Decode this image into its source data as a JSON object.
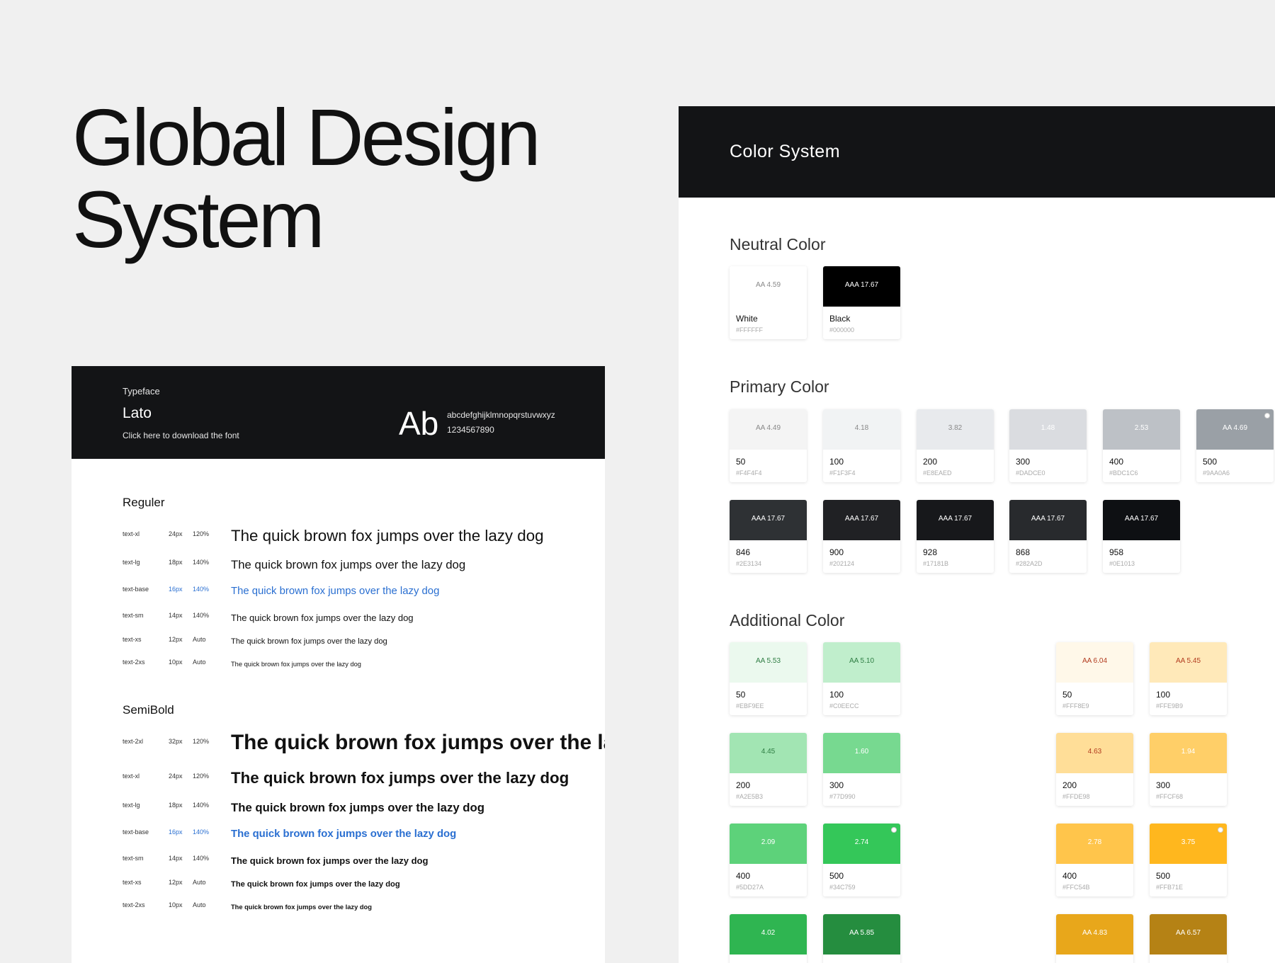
{
  "hero": {
    "line1": "Global Design",
    "line2": "System"
  },
  "typeface": {
    "label": "Typeface",
    "name": "Lato",
    "download": "Click here to download the font",
    "sample": "Ab",
    "alphabet": "abcdefghijklmnopqrstuvwxyz",
    "digits": "1234567890",
    "regular": {
      "title": "Reguler",
      "rows": [
        {
          "token": "text-xl",
          "size": "24px",
          "lh": "120%",
          "text": "The quick brown fox jumps over the lazy dog"
        },
        {
          "token": "text-lg",
          "size": "18px",
          "lh": "140%",
          "text": "The quick brown fox jumps over the lazy dog"
        },
        {
          "token": "text-base",
          "size": "16px",
          "lh": "140%",
          "text": "The quick brown fox jumps over the lazy dog"
        },
        {
          "token": "text-sm",
          "size": "14px",
          "lh": "140%",
          "text": "The quick brown fox jumps over the lazy dog"
        },
        {
          "token": "text-xs",
          "size": "12px",
          "lh": "Auto",
          "text": "The quick brown fox jumps over the lazy dog"
        },
        {
          "token": "text-2xs",
          "size": "10px",
          "lh": "Auto",
          "text": "The quick brown fox jumps over the lazy dog"
        }
      ]
    },
    "semibold": {
      "title": "SemiBold",
      "rows": [
        {
          "token": "text-2xl",
          "size": "32px",
          "lh": "120%",
          "text": "The quick brown fox jumps over the lazy dog"
        },
        {
          "token": "text-xl",
          "size": "24px",
          "lh": "120%",
          "text": "The quick brown fox jumps over the lazy dog"
        },
        {
          "token": "text-lg",
          "size": "18px",
          "lh": "140%",
          "text": "The quick brown fox jumps over the lazy dog"
        },
        {
          "token": "text-base",
          "size": "16px",
          "lh": "140%",
          "text": "The quick brown fox jumps over the lazy dog"
        },
        {
          "token": "text-sm",
          "size": "14px",
          "lh": "140%",
          "text": "The quick brown fox jumps over the lazy dog"
        },
        {
          "token": "text-xs",
          "size": "12px",
          "lh": "Auto",
          "text": "The quick brown fox jumps over the lazy dog"
        },
        {
          "token": "text-2xs",
          "size": "10px",
          "lh": "Auto",
          "text": "The quick brown fox jumps over the lazy dog"
        }
      ]
    }
  },
  "colors": {
    "title": "Color System",
    "neutral_title": "Neutral Color",
    "primary_title": "Primary Color",
    "additional_title": "Additional Color",
    "neutral": [
      {
        "name": "White",
        "hex": "#FFFFFF",
        "ratio": "AA 4.59",
        "color": "#FFFFFF",
        "text": "#888888"
      },
      {
        "name": "Black",
        "hex": "#000000",
        "ratio": "AAA 17.67",
        "color": "#000000",
        "text": "#FFFFFF"
      }
    ],
    "primary": [
      {
        "name": "50",
        "hex": "#F4F4F4",
        "ratio": "AA 4.49",
        "color": "#F4F4F4",
        "text": "#888888"
      },
      {
        "name": "100",
        "hex": "#F1F3F4",
        "ratio": "4.18",
        "color": "#F1F3F4",
        "text": "#888888"
      },
      {
        "name": "200",
        "hex": "#E8EAED",
        "ratio": "3.82",
        "color": "#E8EAED",
        "text": "#888888"
      },
      {
        "name": "300",
        "hex": "#DADCE0",
        "ratio": "1.48",
        "color": "#DADCE0",
        "text": "#FFFFFF"
      },
      {
        "name": "400",
        "hex": "#BDC1C6",
        "ratio": "2.53",
        "color": "#BDC1C6",
        "text": "#FFFFFF"
      },
      {
        "name": "500",
        "hex": "#9AA0A6",
        "ratio": "AA 4.69",
        "color": "#9AA0A6",
        "text": "#FFFFFF",
        "selected": true
      },
      {
        "name": "846",
        "hex": "#2E3134",
        "ratio": "AAA 17.67",
        "color": "#2E3134",
        "text": "#FFFFFF"
      },
      {
        "name": "900",
        "hex": "#202124",
        "ratio": "AAA 17.67",
        "color": "#202124",
        "text": "#FFFFFF"
      },
      {
        "name": "928",
        "hex": "#17181B",
        "ratio": "AAA 17.67",
        "color": "#17181B",
        "text": "#FFFFFF"
      },
      {
        "name": "868",
        "hex": "#282A2D",
        "ratio": "AAA 17.67",
        "color": "#282A2D",
        "text": "#FFFFFF"
      },
      {
        "name": "958",
        "hex": "#0E1013",
        "ratio": "AAA 17.67",
        "color": "#0E1013",
        "text": "#FFFFFF"
      }
    ],
    "green": [
      {
        "name": "50",
        "hex": "#EBF9EE",
        "ratio": "AA 5.53",
        "color": "#EBF9EE",
        "text": "#2E7D43"
      },
      {
        "name": "100",
        "hex": "#C0EECC",
        "ratio": "AA 5.10",
        "color": "#C0EECC",
        "text": "#2E7D43"
      },
      {
        "name": "200",
        "hex": "#A2E5B3",
        "ratio": "4.45",
        "color": "#A2E5B3",
        "text": "#2E7D43"
      },
      {
        "name": "300",
        "hex": "#77D990",
        "ratio": "1.60",
        "color": "#77D990",
        "text": "#FFFFFF"
      },
      {
        "name": "400",
        "hex": "#5DD27A",
        "ratio": "2.09",
        "color": "#5DD27A",
        "text": "#FFFFFF"
      },
      {
        "name": "500",
        "hex": "#34C759",
        "ratio": "2.74",
        "color": "#34C759",
        "text": "#FFFFFF",
        "selected": true
      },
      {
        "name": "",
        "hex": "",
        "ratio": "4.02",
        "color": "#2FB551",
        "text": "#FFFFFF"
      },
      {
        "name": "",
        "hex": "",
        "ratio": "AA 5.85",
        "color": "#258D3F",
        "text": "#FFFFFF"
      }
    ],
    "yellow": [
      {
        "name": "50",
        "hex": "#FFF8E9",
        "ratio": "AA 6.04",
        "color": "#FFF8E9",
        "text": "#B23A1E"
      },
      {
        "name": "100",
        "hex": "#FFE9B9",
        "ratio": "AA 5.45",
        "color": "#FFE9B9",
        "text": "#B23A1E"
      },
      {
        "name": "200",
        "hex": "#FFDE98",
        "ratio": "4.63",
        "color": "#FFDE98",
        "text": "#B23A1E"
      },
      {
        "name": "300",
        "hex": "#FFCF68",
        "ratio": "1.94",
        "color": "#FFCF68",
        "text": "#FFFFFF"
      },
      {
        "name": "400",
        "hex": "#FFC54B",
        "ratio": "2.78",
        "color": "#FFC54B",
        "text": "#FFFFFF"
      },
      {
        "name": "500",
        "hex": "#FFB71E",
        "ratio": "3.75",
        "color": "#FFB71E",
        "text": "#FFFFFF",
        "selected": true
      },
      {
        "name": "",
        "hex": "",
        "ratio": "AA 4.83",
        "color": "#E8A71B",
        "text": "#FFFFFF"
      },
      {
        "name": "",
        "hex": "",
        "ratio": "AA 6.57",
        "color": "#B58215",
        "text": "#FFFFFF"
      }
    ]
  }
}
